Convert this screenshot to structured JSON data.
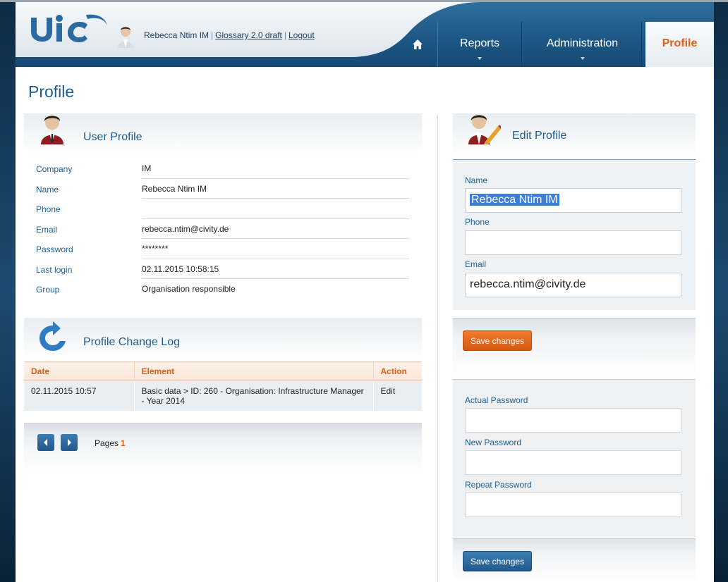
{
  "header": {
    "user_name": "Rebecca Ntim IM",
    "glossary_link": "Glossary 2.0 draft",
    "logout_link": "Logout",
    "sep": "|"
  },
  "nav": {
    "home_icon": "home-icon",
    "reports": "Reports",
    "administration": "Administration",
    "profile": "Profile"
  },
  "page": {
    "title": "Profile"
  },
  "user_profile": {
    "title": "User Profile",
    "fields": [
      {
        "label": "Company",
        "value": "IM"
      },
      {
        "label": "Name",
        "value": "Rebecca Ntim IM"
      },
      {
        "label": "Phone",
        "value": ""
      },
      {
        "label": "Email",
        "value": "rebecca.ntim@civity.de"
      },
      {
        "label": "Password",
        "value": "********"
      },
      {
        "label": "Last login",
        "value": "02.11.2015 10:58:15"
      },
      {
        "label": "Group",
        "value": "Organisation responsible"
      }
    ]
  },
  "change_log": {
    "title": "Profile Change Log",
    "columns": [
      "Date",
      "Element",
      "Action"
    ],
    "rows": [
      {
        "date": "02.11.2015 10:57",
        "element": "Basic data > ID: 260 - Organisation: Infrastructure Manager - Year 2014",
        "action": "Edit"
      }
    ],
    "pages_label": "Pages",
    "current_page": "1"
  },
  "edit_profile": {
    "title": "Edit Profile",
    "name_label": "Name",
    "name_value": "Rebecca Ntim IM",
    "phone_label": "Phone",
    "phone_value": "",
    "email_label": "Email",
    "email_value": "rebecca.ntim@civity.de",
    "save_label": "Save changes"
  },
  "password": {
    "actual_label": "Actual Password",
    "new_label": "New Password",
    "repeat_label": "Repeat Password",
    "save_label": "Save changes"
  },
  "colors": {
    "header_blue": "#1d5683",
    "accent_orange": "#e06018",
    "link_blue": "#1f5d92"
  }
}
